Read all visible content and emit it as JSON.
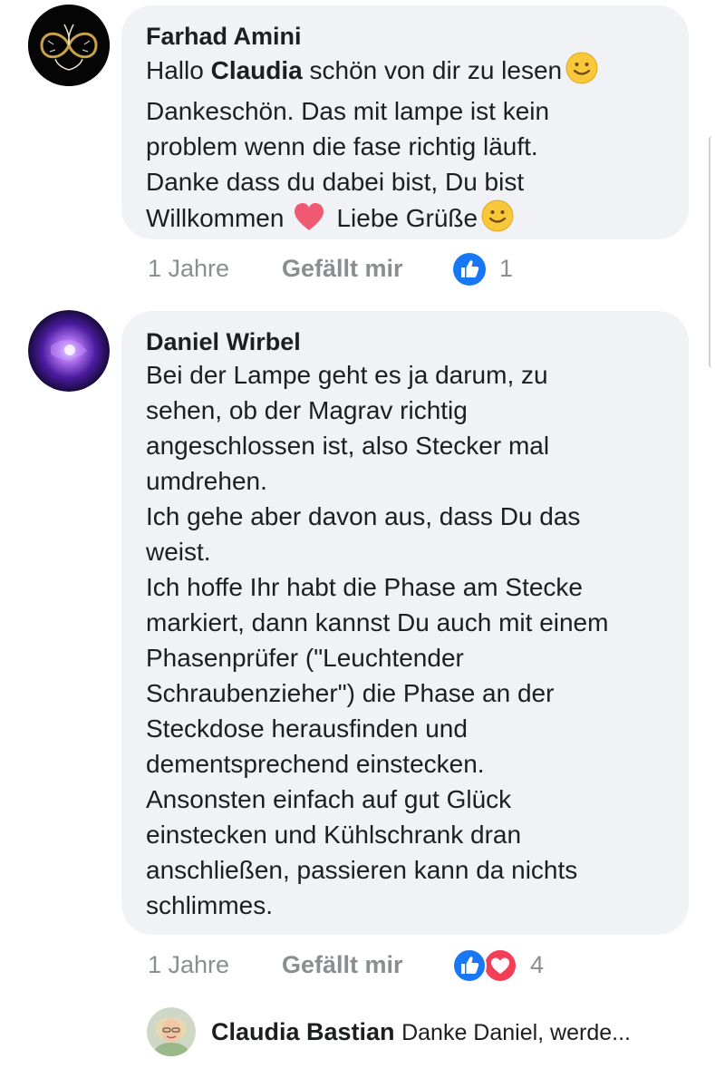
{
  "comments": [
    {
      "author": "Farhad Amini",
      "line1_prefix": "Hallo ",
      "line1_mention": "Claudia",
      "line1_suffix": " schön von dir zu lesen",
      "line2": "Dankeschön. Das mit lampe ist kein",
      "line3": "problem wenn die fase richtig läuft.",
      "line4": "Danke dass du dabei bist, Du bist",
      "line5_a": "Willkommen",
      "line5_b": "Liebe Grüße",
      "time": "1 Jahre",
      "like_label": "Gefällt mir",
      "reaction_count": "1",
      "emoji_icons": [
        "smile-emoji",
        "heart-emoji",
        "smile-emoji"
      ]
    },
    {
      "author": "Daniel Wirbel",
      "lines": [
        "Bei der Lampe geht es ja darum, zu",
        "sehen, ob der Magrav richtig",
        "angeschlossen ist, also Stecker mal",
        "umdrehen.",
        "Ich gehe aber davon aus, dass Du das",
        "weist.",
        "Ich hoffe Ihr habt die Phase am Stecke",
        "markiert, dann kannst Du auch mit einem",
        "Phasenprüfer (\"Leuchtender",
        "Schraubenzieher\") die Phase an der",
        "Steckdose herausfinden und",
        "dementsprechend einstecken.",
        "Ansonsten einfach auf gut Glück",
        "einstecken und Kühlschrank dran",
        "anschließen, passieren kann da nichts",
        "schlimmes."
      ],
      "time": "1 Jahre",
      "like_label": "Gefällt mir",
      "reaction_count": "4"
    }
  ],
  "reply_preview": {
    "author": "Claudia Bastian",
    "text": "Danke Daniel, werde..."
  },
  "colors": {
    "bubble": "#f0f2f5",
    "meta": "#8a8d91",
    "like_blue": "#1877f2",
    "love_red": "#f33e58"
  }
}
